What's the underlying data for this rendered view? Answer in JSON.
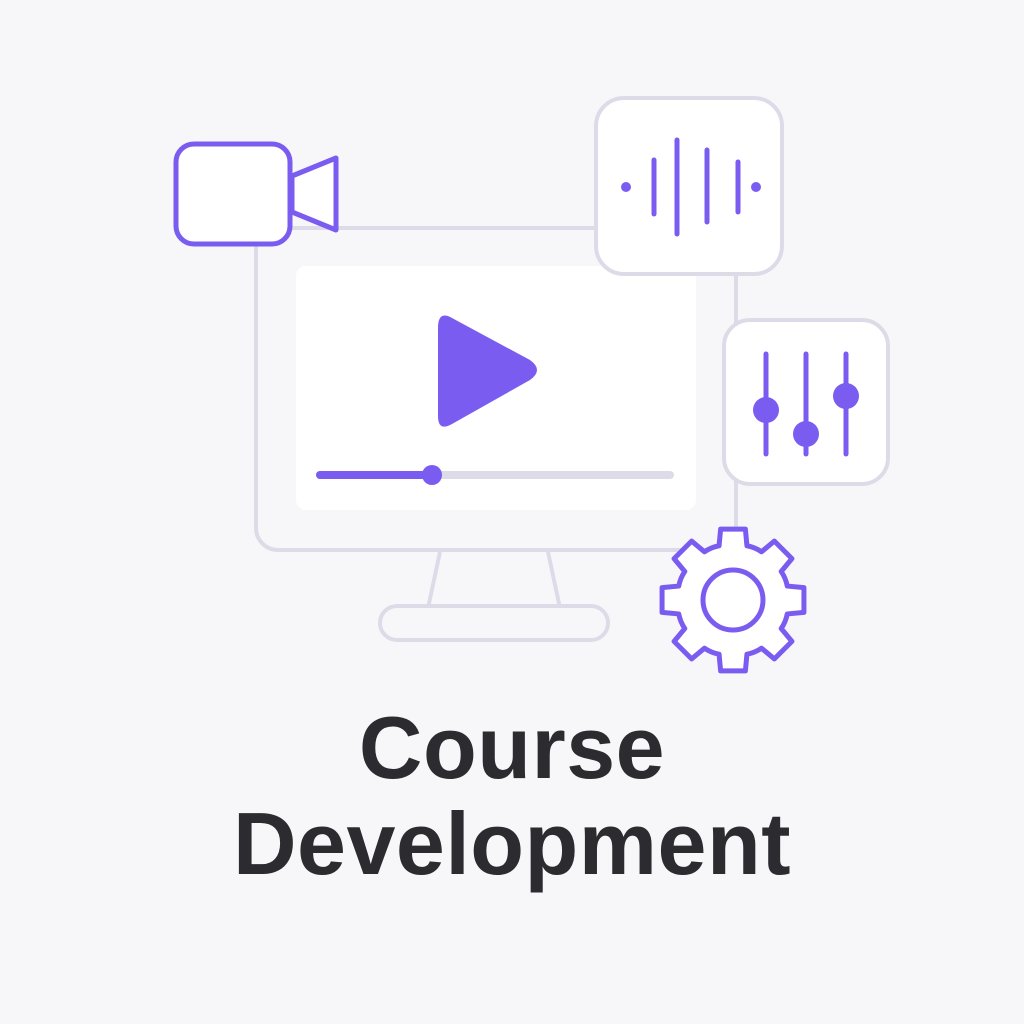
{
  "title": {
    "line1": "Course",
    "line2": "Development"
  },
  "colors": {
    "background": "#f7f7f9",
    "accent": "#7b5cf0",
    "outline": "#dedbe8",
    "text": "#2b2b30"
  },
  "icons": {
    "monitor": "monitor-icon",
    "play": "play-icon",
    "video_camera": "video-camera-icon",
    "audio_waveform": "audio-waveform-icon",
    "equalizer_sliders": "equalizer-sliders-icon",
    "gear": "gear-icon"
  },
  "video_player": {
    "progress": 0.32
  }
}
